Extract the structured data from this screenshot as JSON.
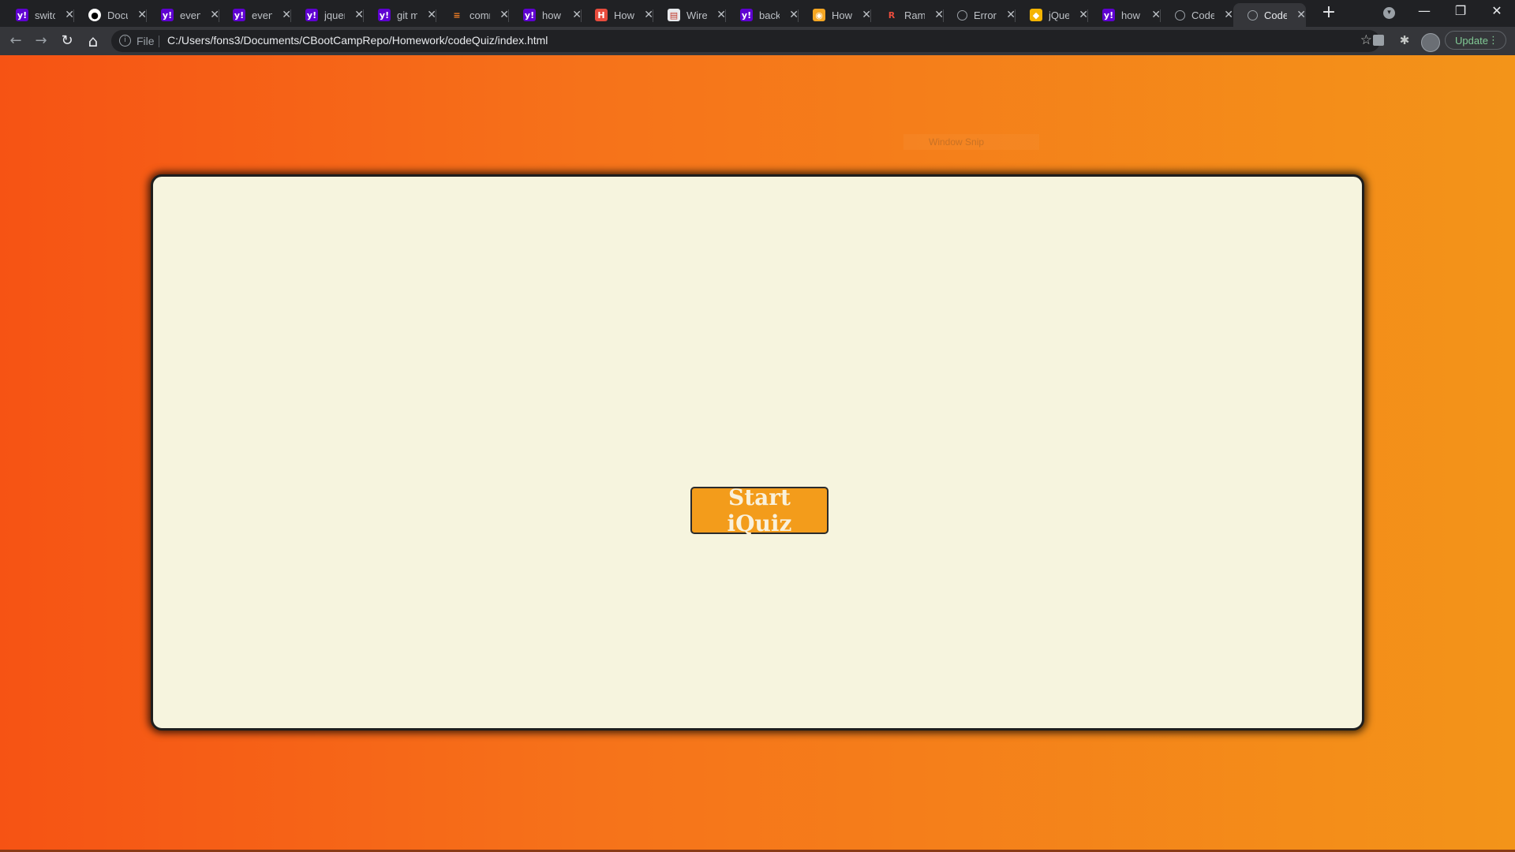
{
  "tabs": [
    {
      "title": "switc",
      "icon": "yahoo-icon",
      "fav": "y!"
    },
    {
      "title": "Docu",
      "icon": "github-icon",
      "fav": "●"
    },
    {
      "title": "even",
      "icon": "yahoo-icon",
      "fav": "y!"
    },
    {
      "title": "even",
      "icon": "yahoo-icon",
      "fav": "y!"
    },
    {
      "title": "jquer",
      "icon": "yahoo-icon",
      "fav": "y!"
    },
    {
      "title": "git m",
      "icon": "yahoo-icon",
      "fav": "y!"
    },
    {
      "title": "comr",
      "icon": "stackoverflow-icon",
      "fav": "≡"
    },
    {
      "title": "how",
      "icon": "yahoo-icon",
      "fav": "y!"
    },
    {
      "title": "How",
      "icon": "red-page-icon",
      "fav": "H"
    },
    {
      "title": "Wire",
      "icon": "wireframe-icon",
      "fav": "▤"
    },
    {
      "title": "back",
      "icon": "yahoo-icon",
      "fav": "y!"
    },
    {
      "title": "How",
      "icon": "orange-search-icon",
      "fav": "◉"
    },
    {
      "title": "Ram",
      "icon": "ramp-icon",
      "fav": "R"
    },
    {
      "title": "Error",
      "icon": "globe-icon",
      "fav": ""
    },
    {
      "title": "jQue",
      "icon": "jquery-icon",
      "fav": "◆"
    },
    {
      "title": "how",
      "icon": "yahoo-icon",
      "fav": "y!"
    },
    {
      "title": "Code",
      "icon": "globe-icon",
      "fav": ""
    },
    {
      "title": "Code",
      "icon": "globe-icon",
      "fav": ""
    }
  ],
  "window": {
    "minimize": "—",
    "restore": "❐",
    "close": "✕",
    "new_tab": "+",
    "tab_search": "▾"
  },
  "toolbar": {
    "back": "←",
    "forward": "→",
    "reload": "↻",
    "home": "⌂",
    "info": "i",
    "scheme": "File",
    "url": "C:/Users/fons3/Documents/CBootCampRepo/Homework/codeQuiz/index.html",
    "star": "☆",
    "extensions": "✱",
    "update_label": "Update",
    "menu": "⋮"
  },
  "overlay": {
    "snip_label": "Window Snip"
  },
  "page": {
    "start_button": "Start iQuiz"
  }
}
